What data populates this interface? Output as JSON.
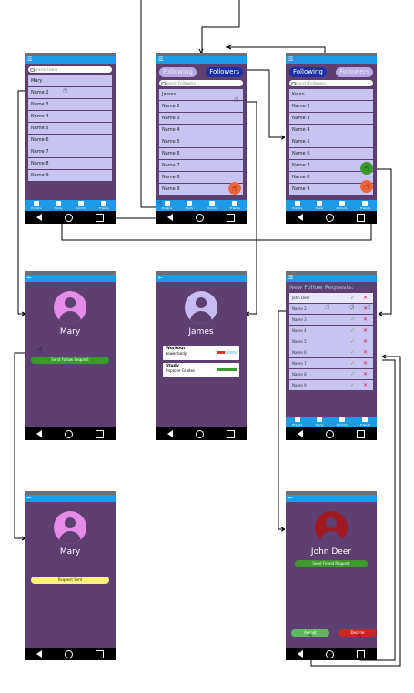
{
  "common": {
    "menu_icon": "☰",
    "back_icon": "←",
    "search_following_placeholder": "Search Users",
    "search_followers_placeholder": "Search Followers",
    "search_followers2_placeholder": "Search Followers"
  },
  "screen_following_list": {
    "items": [
      "Mary",
      "Name 2",
      "Name 3",
      "Name 4",
      "Name 5",
      "Name 6",
      "Name 7",
      "Name 8",
      "Name 9"
    ]
  },
  "screen_following_toggle": {
    "following_label": "Following",
    "followers_label": "Followers",
    "items": [
      "James",
      "Name 2",
      "Name 3",
      "Name 4",
      "Name 5",
      "Name 6",
      "Name 7",
      "Name 8",
      "Name 9"
    ]
  },
  "screen_followers_toggle": {
    "following_label": "Following",
    "followers_label": "Followers",
    "items": [
      "Kevin",
      "Name 2",
      "Name 3",
      "Name 4",
      "Name 5",
      "Name 6",
      "Name 7",
      "Name 8",
      "Name 9"
    ]
  },
  "tabs": [
    "Explore",
    "Study",
    "Pomodo",
    "Friends"
  ],
  "screen_mary_send": {
    "name": "Mary",
    "button": "Send Follow Request"
  },
  "screen_james": {
    "name": "James",
    "cards": [
      {
        "title": "Workout",
        "subtitle": "Lower body"
      },
      {
        "title": "Study",
        "subtitle": "Improve Grades"
      }
    ]
  },
  "screen_requests": {
    "title": "New Follow Requests:",
    "items": [
      "John Deer",
      "Name 2",
      "Name 3",
      "Name 4",
      "Name 5",
      "Name 6",
      "Name 7",
      "Name 8",
      "Name 9"
    ]
  },
  "screen_mary_pending": {
    "name": "Mary",
    "button": "Request Sent"
  },
  "screen_john": {
    "name": "John Deer",
    "button": "Send Friend Request",
    "accept": "Accept",
    "decline": "Decline"
  },
  "colors": {
    "purple_bg": "#5e3f72",
    "blue_bar": "#1e9be8",
    "list_row": "#c7c4f4",
    "green": "#3c9a2c",
    "orange": "#f06439",
    "red": "#c62828",
    "pink_avatar": "#e58be8",
    "lavender_avatar": "#c7bdf4",
    "dark_red_avatar": "#a01822"
  }
}
